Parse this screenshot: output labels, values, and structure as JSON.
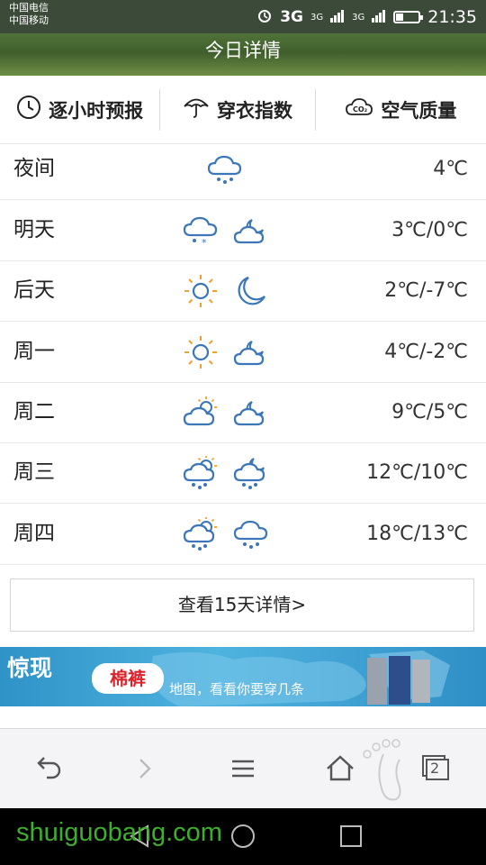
{
  "status_bar": {
    "carrier_1": "中国电信",
    "carrier_2": "中国移动",
    "network_1": "3G",
    "network_2": "3G",
    "network_3": "3G",
    "time": "21:35"
  },
  "header": {
    "title": "今日详情"
  },
  "tabs": [
    {
      "label": "逐小时预报",
      "icon": "clock-icon"
    },
    {
      "label": "穿衣指数",
      "icon": "umbrella-icon"
    },
    {
      "label": "空气质量",
      "icon": "co2-cloud-icon"
    }
  ],
  "forecast": [
    {
      "day": "夜间",
      "temp": "4℃",
      "icons": [
        "rain-cloud"
      ]
    },
    {
      "day": "明天",
      "temp": "3℃/0℃",
      "icons": [
        "sleet-cloud",
        "cloudy-night"
      ]
    },
    {
      "day": "后天",
      "temp": "2℃/-7℃",
      "icons": [
        "sun",
        "moon"
      ]
    },
    {
      "day": "周一",
      "temp": "4℃/-2℃",
      "icons": [
        "sun",
        "cloudy-night"
      ]
    },
    {
      "day": "周二",
      "temp": "9℃/5℃",
      "icons": [
        "partly-cloudy",
        "cloudy-night"
      ]
    },
    {
      "day": "周三",
      "temp": "12℃/10℃",
      "icons": [
        "sun-rain",
        "moon-rain"
      ]
    },
    {
      "day": "周四",
      "temp": "18℃/13℃",
      "icons": [
        "sun-rain",
        "rain-cloud"
      ]
    }
  ],
  "detail_button": {
    "label": "查看15天详情>"
  },
  "ad_banner": {
    "text_1": "惊现",
    "text_2": "棉裤",
    "text_3": "地图，看看你要穿几条"
  },
  "toolbar": {
    "tab_count": "2"
  },
  "watermark": {
    "text": "shuiguobang.com"
  },
  "colors": {
    "icon_blue": "#3a76b8",
    "sun_orange": "#f0a030",
    "header_green": "#4d6e36"
  }
}
